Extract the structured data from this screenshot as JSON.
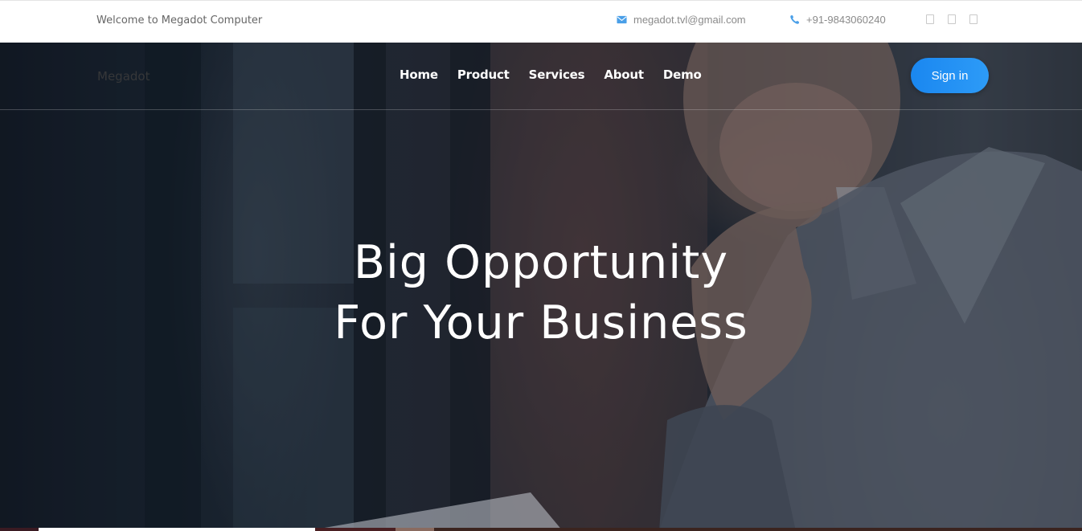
{
  "topbar": {
    "welcome": "Welcome to Megadot Computer",
    "email": "megadot.tvl@gmail.com",
    "phone": "+91-9843060240",
    "email_icon": "envelope-icon",
    "phone_icon": "phone-icon",
    "social_icons": [
      "facebook-icon",
      "twitter-icon",
      "linkedin-icon"
    ]
  },
  "nav": {
    "logo": "Megadot",
    "items": [
      "Home",
      "Product",
      "Services",
      "About",
      "Demo"
    ],
    "signin": "Sign in"
  },
  "hero": {
    "line1": "Big Opportunity",
    "line2": "For Your Business"
  },
  "colors": {
    "accent": "#1a87f0",
    "email_icon": "#4a9fe8",
    "phone_icon": "#4a9fe8"
  }
}
